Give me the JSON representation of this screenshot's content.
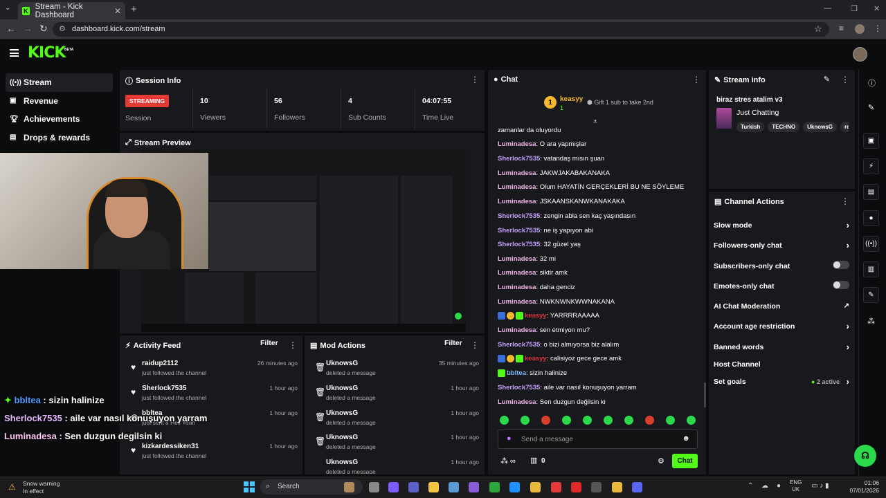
{
  "browser": {
    "tab_title": "Stream - Kick Dashboard",
    "url": "dashboard.kick.com/stream",
    "close": "✕",
    "new_tab": "+"
  },
  "header": {
    "logo": "KICK",
    "beta": "BETA"
  },
  "sidebar": {
    "items": [
      {
        "label": "Stream",
        "icon": "broadcast-icon"
      },
      {
        "label": "Revenue",
        "icon": "wallet-icon"
      },
      {
        "label": "Achievements",
        "icon": "trophy-icon"
      },
      {
        "label": "Drops & rewards",
        "icon": "gift-icon"
      }
    ]
  },
  "session": {
    "title": "Session Info",
    "status": "STREAMING",
    "status_label": "Session",
    "stats": [
      {
        "value": "10",
        "label": "Viewers"
      },
      {
        "value": "56",
        "label": "Followers"
      },
      {
        "value": "4",
        "label": "Sub Counts"
      },
      {
        "value": "04:07:55",
        "label": "Time Live"
      }
    ]
  },
  "preview": {
    "title": "Stream Preview"
  },
  "activity": {
    "title": "Activity Feed",
    "filter": "Filter",
    "items": [
      {
        "user": "raidup2112",
        "action": "just followed the channel",
        "time": "26 minutes ago"
      },
      {
        "user": "Sherlock7535",
        "action": "just followed the channel",
        "time": "1 hour ago"
      },
      {
        "user": "bbltea",
        "action": "just sent a Hell Yeah",
        "time": "1 hour ago"
      },
      {
        "user": "kizkardessiken31",
        "action": "just followed the channel",
        "time": "1 hour ago"
      }
    ]
  },
  "mod": {
    "title": "Mod Actions",
    "filter": "Filter",
    "items": [
      {
        "user": "UknowsG",
        "action": "deleted a message",
        "time": "35 minutes ago"
      },
      {
        "user": "UknowsG",
        "action": "deleted a message",
        "time": "1 hour ago"
      },
      {
        "user": "UknowsG",
        "action": "deleted a message",
        "time": "1 hour ago"
      },
      {
        "user": "UknowsG",
        "action": "deleted a message",
        "time": "1 hour ago"
      },
      {
        "user": "UknowsG",
        "action": "deleted a message",
        "time": "1 hour ago"
      }
    ]
  },
  "chat": {
    "title": "Chat",
    "pinned_user": "keasyy",
    "pinned_count": "1",
    "gift_text": "Gift 1 sub to take 2nd",
    "messages": [
      {
        "user": "",
        "text": "zamanlar da oluyordu",
        "color": "none"
      },
      {
        "user": "Luminadesa",
        "text": ": O ara yapmışlar",
        "color": "pink"
      },
      {
        "user": "Sherlock7535",
        "text": ": vatandaş mısın şuan",
        "color": "purple"
      },
      {
        "user": "Luminadesa",
        "text": ": JAKWJAKABAKANAKA",
        "color": "pink"
      },
      {
        "user": "Luminadesa",
        "text": ": Olum HAYATİN GERÇEKLERİ BU NE SÖYLEME",
        "color": "pink"
      },
      {
        "user": "Luminadesa",
        "text": ": JSKAANSKANWKANAKAKA",
        "color": "pink"
      },
      {
        "user": "Sherlock7535",
        "text": ": zengin abla sen kaç yaşındasın",
        "color": "purple"
      },
      {
        "user": "Sherlock7535",
        "text": ": ne iş yapıyon abi",
        "color": "purple"
      },
      {
        "user": "Sherlock7535",
        "text": ": 32 güzel yaş",
        "color": "purple"
      },
      {
        "user": "Luminadesa",
        "text": ": 32 mi",
        "color": "pink"
      },
      {
        "user": "Luminadesa",
        "text": ": siktir amk",
        "color": "pink"
      },
      {
        "user": "Luminadesa",
        "text": ": daha genciz",
        "color": "pink"
      },
      {
        "user": "Luminadesa",
        "text": ": NWKNWNKWWNAKANA",
        "color": "pink"
      },
      {
        "user": "keasyy",
        "text": ": YARRRRAAAAA",
        "color": "red",
        "badges": true
      },
      {
        "user": "Luminadesa",
        "text": ": sen etmiyon mu?",
        "color": "pink"
      },
      {
        "user": "Sherlock7535",
        "text": ": o bizi almıyorsa biz alalım",
        "color": "purple"
      },
      {
        "user": "keasyy",
        "text": ": calisiyoz gece gece amk",
        "color": "red",
        "badges": true
      },
      {
        "user": "bbltea",
        "text": ": sizin halinize",
        "color": "blue",
        "badge": true
      },
      {
        "user": "Sherlock7535",
        "text": ": aile var nasıl konuşuyon yarram",
        "color": "purple"
      },
      {
        "user": "Luminadesa",
        "text": ": Sen duzgun değilsin ki",
        "color": "pink"
      }
    ],
    "placeholder": "Send a message",
    "points": "0",
    "send_label": "Chat"
  },
  "stream_info": {
    "title": "Stream info",
    "stream_title": "biraz stres atalim v3",
    "category": "Just Chatting",
    "tags": [
      "Turkish",
      "TECHNO",
      "UknowsG",
      "re"
    ]
  },
  "channel_actions": {
    "title": "Channel Actions",
    "items": [
      {
        "label": "Slow mode",
        "control": "arrow"
      },
      {
        "label": "Followers-only chat",
        "control": "arrow"
      },
      {
        "label": "Subscribers-only chat",
        "control": "toggle"
      },
      {
        "label": "Emotes-only chat",
        "control": "toggle"
      },
      {
        "label": "AI Chat Moderation",
        "control": "external"
      },
      {
        "label": "Account age restriction",
        "control": "arrow"
      },
      {
        "label": "Banned words",
        "control": "arrow"
      },
      {
        "label": "Host Channel",
        "control": "none"
      },
      {
        "label": "Set goals",
        "control": "arrow",
        "extra": "2 active"
      }
    ]
  },
  "overlay": {
    "lines": [
      {
        "user": "bbltea",
        "text": " : sizin halinize",
        "color": "#4a9bff"
      },
      {
        "user": "Sherlock7535",
        "text": " : aile var nasıl konuşuyon yarram",
        "color": "#e8b8ff"
      },
      {
        "user": "Luminadesa",
        "text": " : Sen duzgun degilsin ki",
        "color": "#ffc6f3"
      }
    ]
  },
  "taskbar": {
    "weather_title": "Snow warning",
    "weather_sub": "In effect",
    "search": "Search",
    "lang1": "ENG",
    "lang2": "UK",
    "time": "01:06",
    "date": "07/01/2026"
  },
  "colors": {
    "kick_green": "#53fc18",
    "live_red": "#e53935"
  }
}
